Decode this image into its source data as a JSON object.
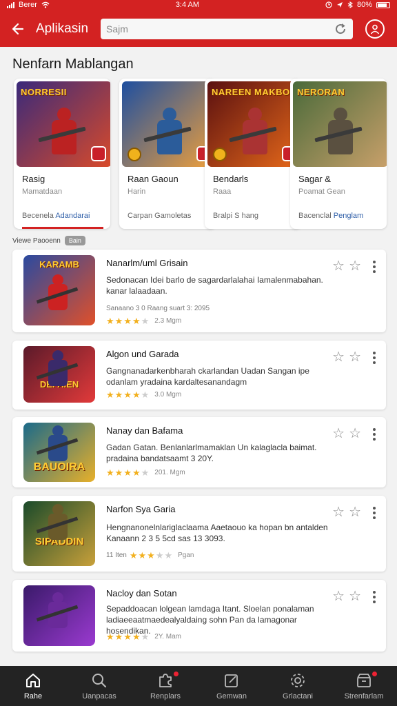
{
  "status_bar": {
    "carrier": "Berer",
    "time": "3:4 AM",
    "battery": "80%"
  },
  "header": {
    "title": "Aplikasin",
    "search_placeholder": "Sajm"
  },
  "section_title": "Nenfarn Mablangan",
  "featured": [
    {
      "art_title": "NORRESII",
      "name": "Rasig",
      "subtitle": "Mamatdaan",
      "footer_main": "Becenela",
      "footer_highlight": "Adandarai",
      "colors": [
        "#3a2a7a",
        "#d94a2a"
      ],
      "figure": "#b22"
    },
    {
      "art_title": "",
      "name": "Raan Gaoun",
      "subtitle": "Harin",
      "footer_main": "Carpan Gamoletas",
      "footer_highlight": "",
      "colors": [
        "#1e4fa0",
        "#f2a13a"
      ],
      "figure": "#2b5c9a"
    },
    {
      "art_title": "NAREEN MAKBOAK",
      "name": "Bendarls",
      "subtitle": "Raaa",
      "footer_main": "Bralpi S hang",
      "footer_highlight": "",
      "colors": [
        "#5a1010",
        "#e86a1a"
      ],
      "figure": "#a33"
    },
    {
      "art_title": "NERORAN",
      "name": "Sagar &",
      "subtitle": "Poamat Gean",
      "footer_main": "Bacenclal",
      "footer_highlight": "Penglam",
      "colors": [
        "#4a6a3a",
        "#c8a06a"
      ],
      "figure": "#5a5040"
    }
  ],
  "sub_row": {
    "label": "Viewe Paooenn",
    "chip": "Bain"
  },
  "list": [
    {
      "thumb_title": "KARAMB",
      "name": "Nanarlm/uml Grisain",
      "description": "Sedonacan Idei barlo de sagardarlalahai Iamalenmabahan. kanar lalaadaan.",
      "meta_text": "Sanaano 3 0 Raang suart 3: 2095",
      "rating": 4,
      "date": "2.3 Mgm",
      "colors": [
        "#2a4aa0",
        "#e0502a"
      ],
      "figure": "#c22"
    },
    {
      "thumb_title": "DEFAIEN",
      "name": "Algon und Garada",
      "description": "Gangnanadarkenbharah ckarlandan Uadan Sangan ipe odanlam yradaina kardaltesanandagm",
      "meta_text": "",
      "rating": 4,
      "date": "3.0 Mgm",
      "colors": [
        "#5a1a2a",
        "#e23a3a"
      ],
      "figure": "#3a2a6a"
    },
    {
      "thumb_title": "BAUOIRA",
      "name": "Nanay dan Bafama",
      "description": "Gadan Gatan. Benlanlarlmamaklan Un kalaglacla baimat. pradaina bandatsaamt 3 20Y.",
      "meta_text": "",
      "rating": 4,
      "date": "201. Mgm",
      "colors": [
        "#1a6a8a",
        "#e8b02a"
      ],
      "figure": "#2a4a8a"
    },
    {
      "thumb_title": "SIPADDIN",
      "name": "Narfon Sya Garia",
      "description": "Hengnanonelnlariglaclaama Aaetaouo ka hopan bn antalden Kanaann 2 3 5 5cd sas 13 3093.",
      "meta_text": "11 Iten",
      "rating": 3,
      "date": "Pgan",
      "colors": [
        "#1a4a2a",
        "#c8a03a"
      ],
      "figure": "#6a5a2a"
    },
    {
      "thumb_title": "",
      "name": "Nacloy dan Sotan",
      "description": "Sepaddoacan lolgean lamdaga Itant. Sloelan ponalaman ladiaeeaatmaedealyaldaing sohn Pan da lamagonar hosendikan.",
      "meta_text": "",
      "rating": 4,
      "date": "2Y. Mam",
      "colors": [
        "#3a1a6a",
        "#9a3ad0"
      ],
      "figure": "#6a2a9a"
    }
  ],
  "bottom_nav": [
    {
      "label": "Rahe",
      "icon": "home-icon",
      "active": true
    },
    {
      "label": "Uanpacas",
      "icon": "search-icon",
      "active": false
    },
    {
      "label": "Renplars",
      "icon": "puzzle-icon",
      "active": false
    },
    {
      "label": "Gemwan",
      "icon": "edit-icon",
      "active": false
    },
    {
      "label": "Grlactani",
      "icon": "settings-icon",
      "active": false
    },
    {
      "label": "Strenfarlam",
      "icon": "store-icon",
      "active": false
    }
  ],
  "colors": {
    "primary": "#d32222",
    "star": "#f2b01e",
    "link": "#2f5fa8",
    "nav_bg": "#232323"
  }
}
